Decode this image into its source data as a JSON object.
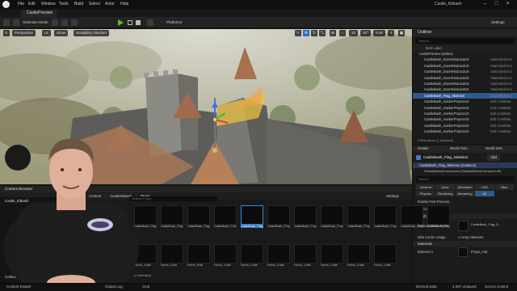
{
  "menu": [
    "File",
    "Edit",
    "Window",
    "Tools",
    "Build",
    "Select",
    "Actor",
    "Help"
  ],
  "project_name": "Castle_Kitbash",
  "map_tab": "CastlePreview",
  "toolbar": {
    "selection_mode": "Selection Mode",
    "platforms": "Platforms",
    "settings": "Settings"
  },
  "viewport": {
    "perspective": "Perspective",
    "lit": "Lit",
    "show": "Show",
    "scalability": "Scalability: Medium",
    "grid": "10",
    "angle": "10°",
    "scale": "0.25",
    "speed": "4"
  },
  "outliner": {
    "title": "Outliner",
    "search_placeholder": "Search...",
    "col_item": "Item Label",
    "rows": [
      {
        "label": "CastlePreview (Editor)",
        "type": "",
        "sel": false
      },
      {
        "label": "CastleBash_DoorWindow2U0",
        "type": "StaticMeshAct",
        "sel": false
      },
      {
        "label": "CastleBash_DoorWindow2U0",
        "type": "StaticMeshAct",
        "sel": false
      },
      {
        "label": "CastleBash_DoorWindow2U0",
        "type": "StaticMeshAct",
        "sel": false
      },
      {
        "label": "CastleBash_DoorWindow2U0",
        "type": "StaticMeshAct",
        "sel": false
      },
      {
        "label": "CastleBash_DoorWindow2U0",
        "type": "StaticMeshAct",
        "sel": false
      },
      {
        "label": "CastleBash_DoorWindow2U0",
        "type": "StaticMeshAct",
        "sel": false
      },
      {
        "label": "CastleBash_Flag_Skeleton",
        "type": "StaticMeshAct",
        "sel": true
      },
      {
        "label": "CastleBash_markerProps1U0",
        "type": "Edit CastleBa",
        "sel": false
      },
      {
        "label": "CastleBash_markerProps1U0",
        "type": "Edit CastleBa",
        "sel": false
      },
      {
        "label": "CastleBash_markerProps1U0",
        "type": "Edit CastleBa",
        "sel": false
      },
      {
        "label": "CastleBash_markerProps1U0",
        "type": "Edit CastleBa",
        "sel": false
      },
      {
        "label": "CastleBash_markerProps1U0",
        "type": "Edit CastleBa",
        "sel": false
      },
      {
        "label": "CastleBash_markerProps1U0",
        "type": "Edit CastleBa",
        "sel": false
      }
    ],
    "count": "2,555 actors (1 selected)"
  },
  "details": {
    "tabs": [
      "Details",
      "World Part...",
      "World Sett..."
    ],
    "actor_name": "CastleBash_Flag_Skeleton",
    "add_button": "Add",
    "instance_row": "CastleBash_Flag_Skeleton (Instance)",
    "component_row": "SkeletalMeshComponent (SkeletalMeshComponent0)",
    "search_placeholder": "Search",
    "category_buttons": [
      "General",
      "Actor",
      "Animation",
      "LOD",
      "Misc",
      "Physics",
      "Rendering",
      "Streaming",
      "All"
    ],
    "advanced": "Advanced",
    "mesh_header": "Mesh",
    "mesh_label": "Skeletal Mesh Asset",
    "mesh_value": "CastleBash_Flag_S...",
    "skin_cache": "Skin Cache Usage",
    "skin_cache_value": "1 Array elements",
    "materials_header": "Materials",
    "element_label": "Element 0",
    "element_value": "Props_mat",
    "enable_post": "Enable Post Process..."
  },
  "content_browser": {
    "title": "Content Browser",
    "breadcrumb": [
      "All",
      "Content",
      "CastleKitbash",
      "Props"
    ],
    "search_placeholder": "Search Props",
    "settings": "Settings",
    "tree_root": "Castle_Kitbash",
    "collections": "Collections",
    "selected_info": "(1 selected)",
    "row1_labels": [
      "CastleBash_Flag_Sign",
      "CastleBash_Flag_Mat",
      "CastleBash_Flag_Bat",
      "CastleBash_Pole_Mesh",
      "CastleBash_Flag_Skeleton",
      "CastleBash_Props_TypeFlag",
      "CastleBash_Props_TypeRoof",
      "CastleBash_Props_TypeBeam",
      "CastleBash_Props_Wagon",
      "CastleBash_Props_Gate",
      "CastleBash_Props_Vine",
      "CastleBash_Props_Sign"
    ],
    "row2_labels": [
      "Fence_Crate",
      "Fence_Gear",
      "Fence_Post",
      "Fence_Crate",
      "Fence_Crate",
      "Fence_Crate",
      "Fence_Crate",
      "Fence_Crate",
      "Fence_Crate",
      "Fence_Crate"
    ]
  },
  "status": {
    "content_drawer": "Content Drawer",
    "output_log": "Output Log",
    "cmd": "Cmd",
    "derived_data": "Derived Data",
    "unsaved": "4,307 Unsaved",
    "source_control": "Source Control"
  },
  "colors": {
    "accent_blue": "#2d5a8f",
    "play_green": "#5bbd3a",
    "flag_yellow": "#e9c244",
    "gizmo_blue": "#3c6cff"
  }
}
